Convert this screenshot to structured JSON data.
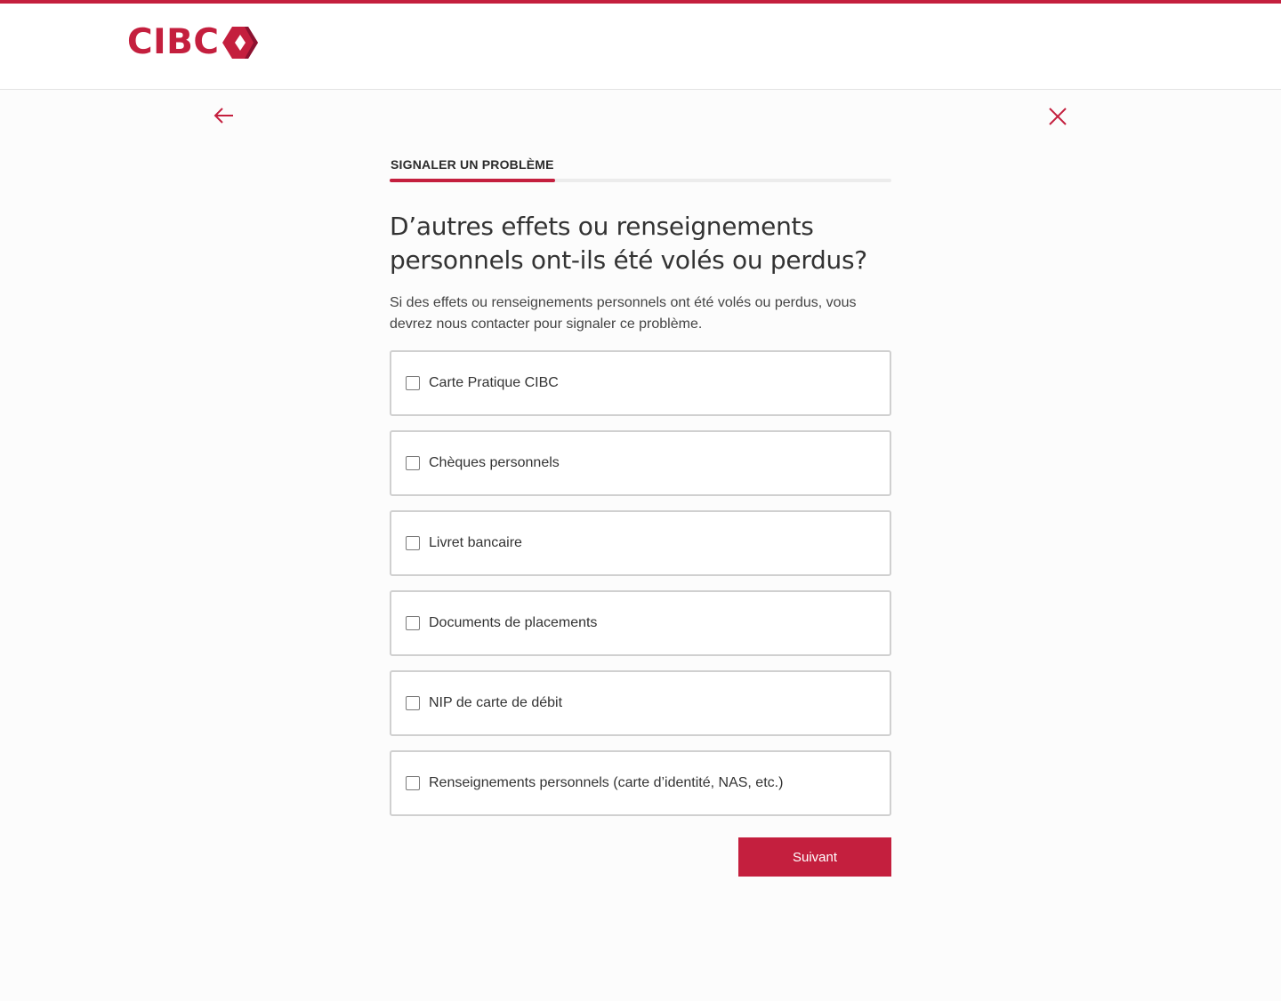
{
  "brand": {
    "logo_text": "CIBC",
    "accent_color": "#c41f3e"
  },
  "nav": {
    "back_icon": "arrow-left-icon",
    "close_icon": "close-icon"
  },
  "form": {
    "step_label": "SIGNALER UN PROBLÈME",
    "progress_fraction": 0.33,
    "question": "D’autres effets ou renseignements personnels ont-ils été volés ou perdus?",
    "helper_text": "Si des effets ou renseignements personnels ont été volés ou perdus, vous devrez nous contacter pour signaler ce problème.",
    "options": [
      {
        "label": "Carte Pratique CIBC",
        "checked": false
      },
      {
        "label": "Chèques personnels",
        "checked": false
      },
      {
        "label": "Livret bancaire",
        "checked": false
      },
      {
        "label": "Documents de placements",
        "checked": false
      },
      {
        "label": "NIP de carte de débit",
        "checked": false
      },
      {
        "label": "Renseignements personnels (carte d’identité, NAS, etc.)",
        "checked": false
      }
    ],
    "next_label": "Suivant"
  }
}
